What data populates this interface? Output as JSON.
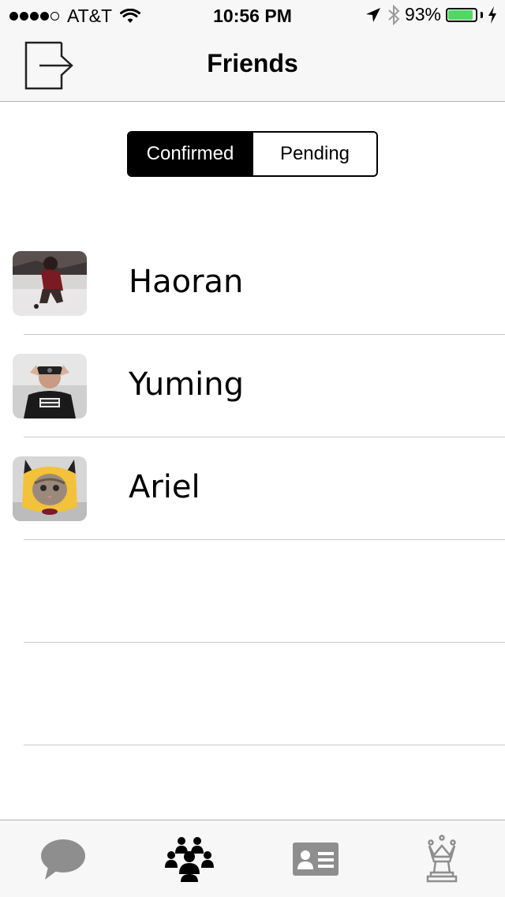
{
  "status_bar": {
    "carrier": "AT&T",
    "time": "10:56 PM",
    "battery_percent": "93%",
    "battery_level": 0.93,
    "signal_bars_filled": 4,
    "signal_bars_total": 5
  },
  "nav": {
    "title": "Friends",
    "logout_icon": "logout-icon"
  },
  "segmented_control": {
    "options": [
      "Confirmed",
      "Pending"
    ],
    "selected": "Confirmed"
  },
  "friends": [
    {
      "name": "Haoran"
    },
    {
      "name": "Yuming"
    },
    {
      "name": "Ariel"
    }
  ],
  "tab_bar": {
    "tabs": [
      {
        "icon": "chat-bubble-icon",
        "selected": false
      },
      {
        "icon": "group-icon",
        "selected": true
      },
      {
        "icon": "contact-card-icon",
        "selected": false
      },
      {
        "icon": "chess-queen-icon",
        "selected": false
      }
    ]
  },
  "colors": {
    "accent": "#000000",
    "inactive_icon": "#8e8e8e",
    "battery": "#4cd964",
    "separator": "#c8c7cc",
    "bar_background": "#f7f7f7"
  }
}
